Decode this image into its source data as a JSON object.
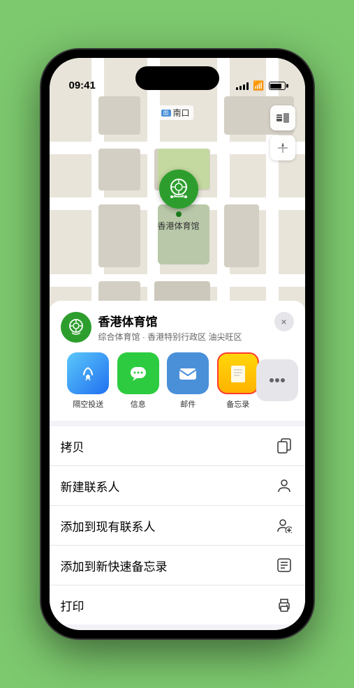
{
  "status": {
    "time": "09:41",
    "location_arrow": "▶"
  },
  "map": {
    "label_text": "南口",
    "stadium_name": "香港体育馆",
    "controls": [
      "🗺",
      "⬆"
    ]
  },
  "venue": {
    "name": "香港体育馆",
    "subtitle": "综合体育馆 · 香港特别行政区 油尖旺区",
    "close_label": "×"
  },
  "share_items": [
    {
      "label": "隔空投送",
      "type": "airdrop"
    },
    {
      "label": "信息",
      "type": "messages"
    },
    {
      "label": "邮件",
      "type": "mail"
    },
    {
      "label": "备忘录",
      "type": "notes",
      "selected": true
    }
  ],
  "actions": [
    {
      "label": "拷贝",
      "icon": "copy"
    },
    {
      "label": "新建联系人",
      "icon": "person"
    },
    {
      "label": "添加到现有联系人",
      "icon": "person-add"
    },
    {
      "label": "添加到新快速备忘录",
      "icon": "note"
    },
    {
      "label": "打印",
      "icon": "print"
    }
  ]
}
